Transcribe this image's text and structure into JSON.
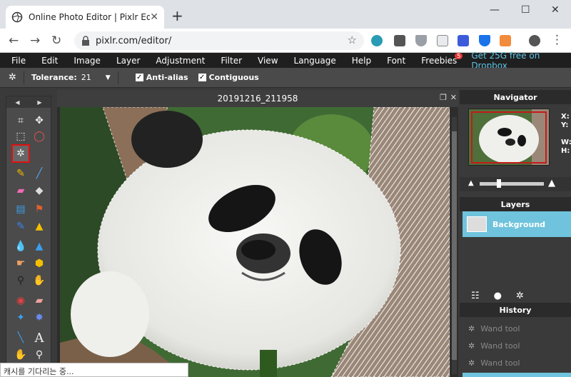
{
  "browser": {
    "tab_title": "Online Photo Editor | Pixlr Edito",
    "url": "pixlr.com/editor/",
    "new_tab": "+",
    "minimize": "—",
    "maximize": "☐",
    "close": "✕"
  },
  "menu": {
    "items": [
      "File",
      "Edit",
      "Image",
      "Layer",
      "Adjustment",
      "Filter",
      "View",
      "Language",
      "Help",
      "Font",
      "Freebies"
    ],
    "freebies_badge": "5",
    "promo": "Get 25G free on Dropbox"
  },
  "options": {
    "tolerance_label": "Tolerance:",
    "tolerance_value": "21",
    "antialias_label": "Anti-alias",
    "antialias_checked": true,
    "contiguous_label": "Contiguous",
    "contiguous_checked": true
  },
  "canvas": {
    "title": "20191216_211958"
  },
  "navigator": {
    "title": "Navigator",
    "x_label": "X:",
    "y_label": "Y:",
    "w_label": "W:",
    "h_label": "H:"
  },
  "layers": {
    "title": "Layers",
    "items": [
      {
        "name": "Background"
      }
    ]
  },
  "history": {
    "title": "History",
    "items": [
      "Wand tool",
      "Wand tool",
      "Wand tool"
    ]
  },
  "status": {
    "text": "캐시를 기다리는 중..."
  },
  "colors": {
    "menubar": "#1f1f1f",
    "promo": "#5ec5e6",
    "selected_layer": "#6fc3dc",
    "selected_tool_outline": "#e01010"
  }
}
